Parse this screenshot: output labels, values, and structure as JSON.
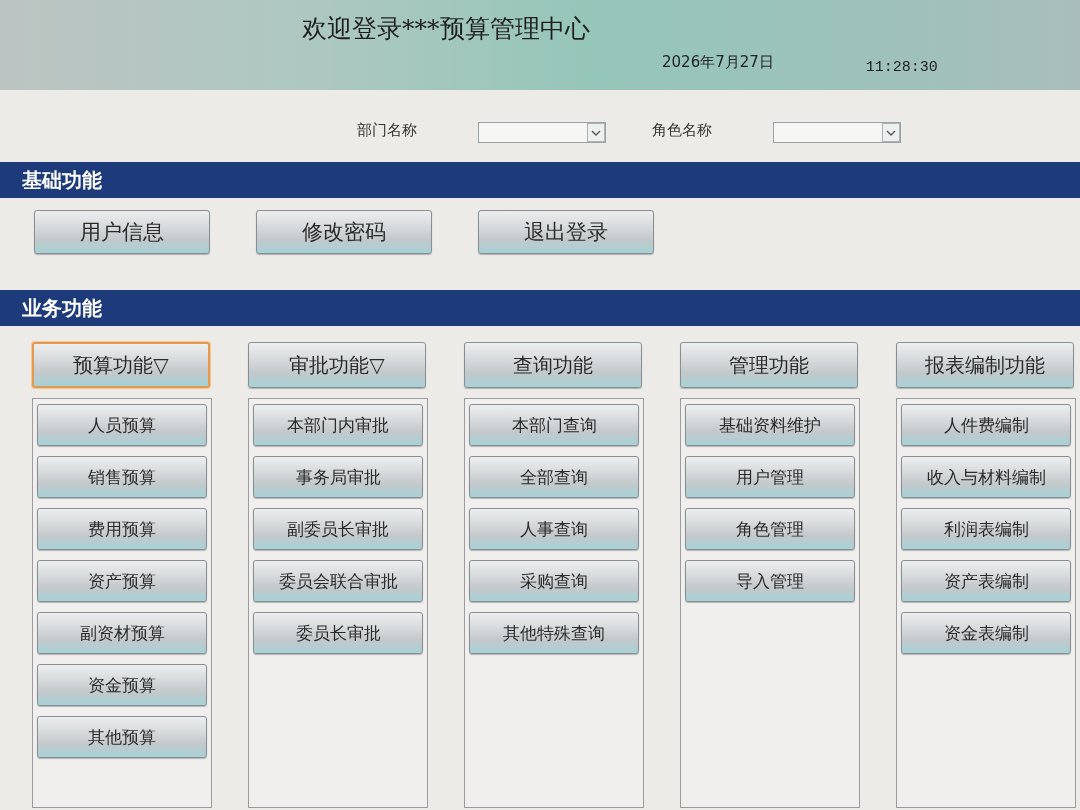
{
  "header": {
    "title": "欢迎登录***预算管理中心",
    "date": "2026年7月27日",
    "time": "11:28:30"
  },
  "filters": [
    {
      "label": "部门名称"
    },
    {
      "label": "角色名称"
    }
  ],
  "basic_section": {
    "title": "基础功能",
    "buttons": [
      "用户信息",
      "修改密码",
      "退出登录"
    ]
  },
  "business_section": {
    "title": "业务功能",
    "columns": [
      {
        "label": "预算功能▽",
        "selected": true,
        "items": [
          "人员预算",
          "销售预算",
          "费用预算",
          "资产预算",
          "副资材预算",
          "资金预算",
          "其他预算"
        ]
      },
      {
        "label": "审批功能▽",
        "selected": false,
        "items": [
          "本部门内审批",
          "事务局审批",
          "副委员长审批",
          "委员会联合审批",
          "委员长审批"
        ]
      },
      {
        "label": "查询功能",
        "selected": false,
        "items": [
          "本部门查询",
          "全部查询",
          "人事查询",
          "采购查询",
          "其他特殊查询"
        ]
      },
      {
        "label": "管理功能",
        "selected": false,
        "items": [
          "基础资料维护",
          "用户管理",
          "角色管理",
          "导入管理"
        ]
      },
      {
        "label": "报表编制功能",
        "selected": false,
        "items": [
          "人件费编制",
          "收入与材料编制",
          "利润表编制",
          "资产表编制",
          "资金表编制"
        ]
      }
    ]
  }
}
